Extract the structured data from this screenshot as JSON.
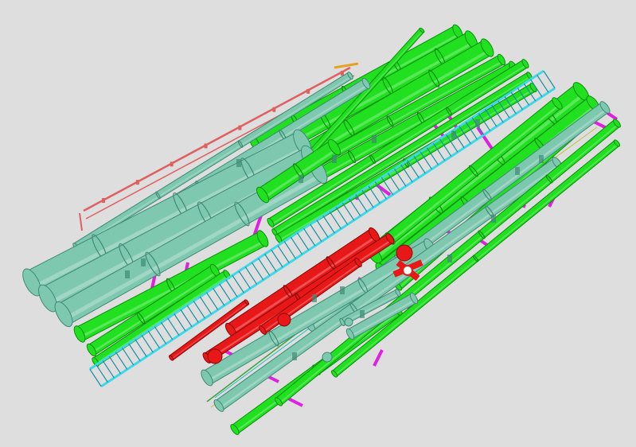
{
  "viewport": {
    "background_color": "#dedede"
  },
  "colors": {
    "green_pipe": "#20e020",
    "green_pipe_dark": "#0a8f0a",
    "teal_pipe": "#7fc8b0",
    "teal_pipe_dark": "#3f8a75",
    "cable_tray": "#40d8e8",
    "cable_tray_dark": "#1a8fa0",
    "red_pipe": "#e81818",
    "red_pipe_dark": "#8a0808",
    "support_magenta": "#e020e0",
    "small_line_red": "#e06060",
    "small_line_orange": "#e8a020"
  }
}
